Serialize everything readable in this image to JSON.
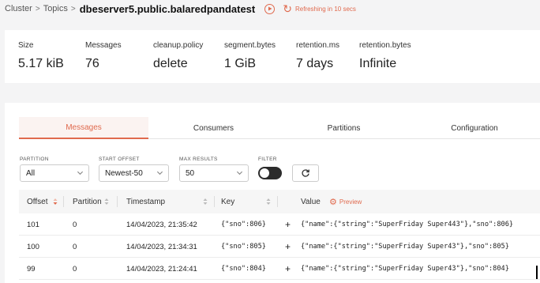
{
  "breadcrumb": {
    "items": [
      "Cluster",
      "Topics"
    ],
    "current": "dbeserver5.public.balaredpandatest",
    "refresh_text": "Refreshing in 10 secs"
  },
  "stats": [
    {
      "label": "Size",
      "value": "5.17 kiB"
    },
    {
      "label": "Messages",
      "value": "76"
    },
    {
      "label": "cleanup.policy",
      "value": "delete"
    },
    {
      "label": "segment.bytes",
      "value": "1 GiB"
    },
    {
      "label": "retention.ms",
      "value": "7 days"
    },
    {
      "label": "retention.bytes",
      "value": "Infinite"
    }
  ],
  "tabs": [
    "Messages",
    "Consumers",
    "Partitions",
    "Configuration"
  ],
  "filters": {
    "partition": {
      "label": "PARTITION",
      "value": "All"
    },
    "start_offset": {
      "label": "START OFFSET",
      "value": "Newest-50"
    },
    "max_results": {
      "label": "MAX RESULTS",
      "value": "50"
    },
    "filter": {
      "label": "FILTER"
    }
  },
  "table": {
    "columns": [
      "Offset",
      "Partition",
      "Timestamp",
      "Key",
      "Value"
    ],
    "preview_label": "Preview",
    "rows": [
      {
        "offset": "101",
        "partition": "0",
        "timestamp": "14/04/2023, 21:35:42",
        "key": "{\"sno\":806}",
        "value": "{\"name\":{\"string\":\"SuperFriday Super443\"},\"sno\":806}"
      },
      {
        "offset": "100",
        "partition": "0",
        "timestamp": "14/04/2023, 21:34:31",
        "key": "{\"sno\":805}",
        "value": "{\"name\":{\"string\":\"SuperFriday Super43\"},\"sno\":805}"
      },
      {
        "offset": "99",
        "partition": "0",
        "timestamp": "14/04/2023, 21:24:41",
        "key": "{\"sno\":804}",
        "value": "{\"name\":{\"string\":\"SuperFriday Super43\"},\"sno\":804}"
      }
    ]
  },
  "colors": {
    "accent": "#e06a4e",
    "toggle": "#2c2c2c"
  }
}
